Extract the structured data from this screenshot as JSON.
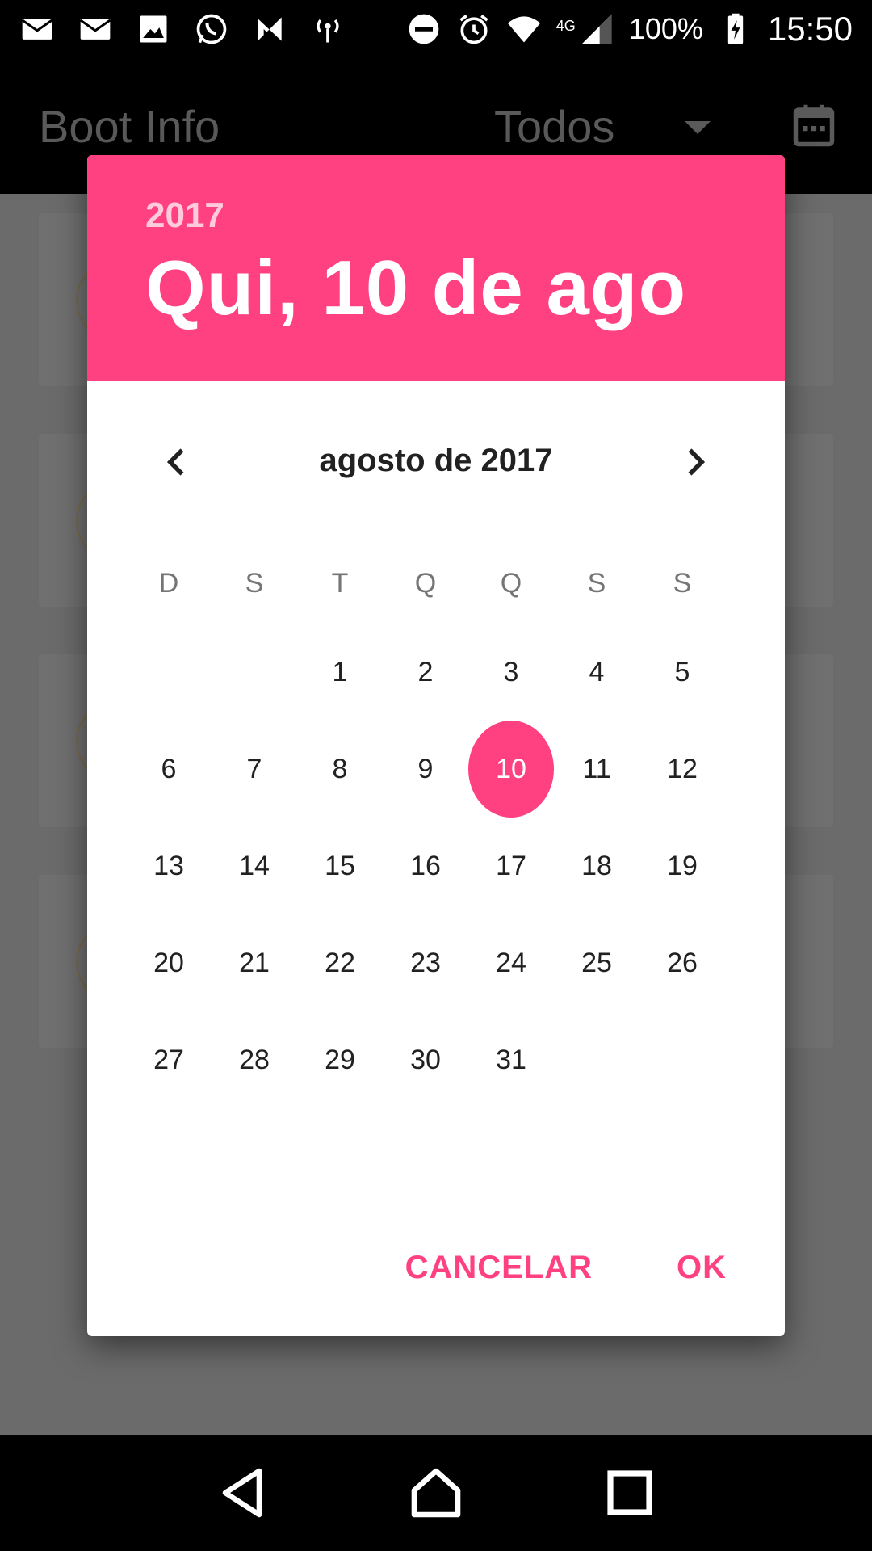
{
  "status_bar": {
    "left_icons": [
      "mail-icon",
      "mail-icon",
      "image-icon",
      "whatsapp-icon",
      "n-icon",
      "wireless-icon"
    ],
    "right_icons": [
      "do-not-disturb-icon",
      "alarm-icon",
      "wifi-icon",
      "signal-icon"
    ],
    "network_type": "4G",
    "battery": "100%",
    "time": "15:50"
  },
  "app_bar": {
    "title": "Boot Info",
    "filter_value": "Todos",
    "calendar_icon": "calendar-icon"
  },
  "dialog": {
    "header_color": "#ff4081",
    "year": "2017",
    "selected_date": "Qui, 10 de ago",
    "month_label": "agosto de 2017",
    "day_headers": [
      "D",
      "S",
      "T",
      "Q",
      "Q",
      "S",
      "S"
    ],
    "weeks": [
      [
        "",
        "",
        "1",
        "2",
        "3",
        "4",
        "5"
      ],
      [
        "6",
        "7",
        "8",
        "9",
        "10",
        "11",
        "12"
      ],
      [
        "13",
        "14",
        "15",
        "16",
        "17",
        "18",
        "19"
      ],
      [
        "20",
        "21",
        "22",
        "23",
        "24",
        "25",
        "26"
      ],
      [
        "27",
        "28",
        "29",
        "30",
        "31",
        "",
        ""
      ]
    ],
    "selected_day": "10",
    "cancel_label": "CANCELAR",
    "ok_label": "OK"
  },
  "nav_bar": {
    "icons": [
      "back-icon",
      "home-icon",
      "recents-icon"
    ]
  }
}
